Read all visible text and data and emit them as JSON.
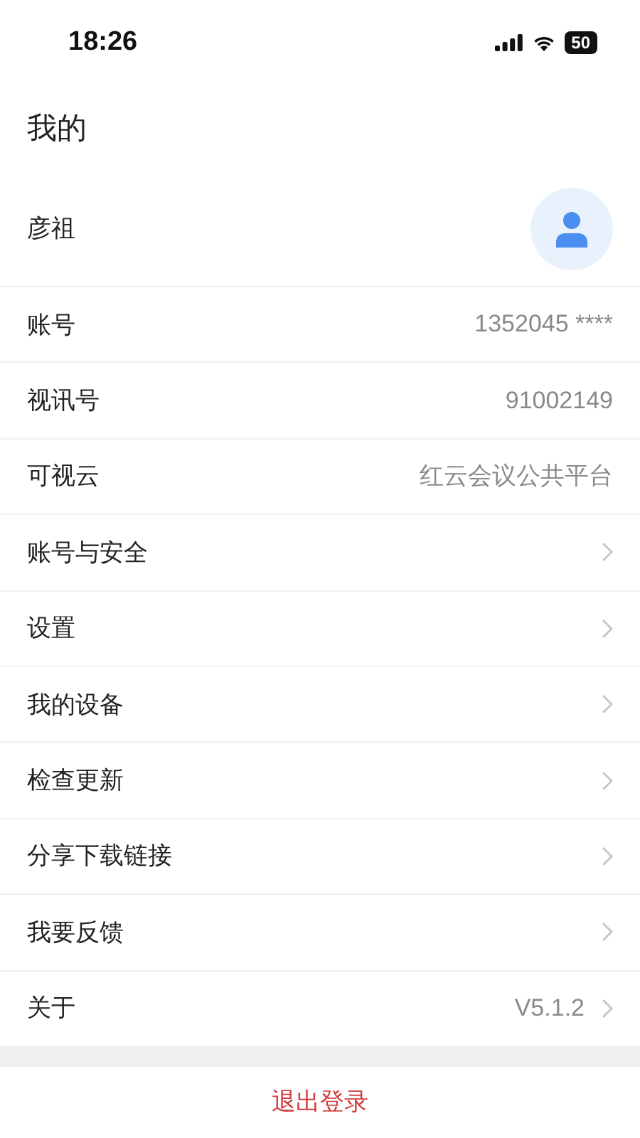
{
  "status_bar": {
    "time": "18:26",
    "battery": "50"
  },
  "title": "我的",
  "profile": {
    "name": "彦祖"
  },
  "rows": [
    {
      "label": "账号",
      "value": "1352045 ****",
      "kind": "info"
    },
    {
      "label": "视讯号",
      "value": "91002149",
      "kind": "info"
    },
    {
      "label": "可视云",
      "value": "红云会议公共平台",
      "kind": "info"
    },
    {
      "label": "账号与安全",
      "kind": "link"
    },
    {
      "label": "设置",
      "kind": "link"
    },
    {
      "label": "我的设备",
      "kind": "link"
    },
    {
      "label": "检查更新",
      "kind": "link"
    },
    {
      "label": "分享下载链接",
      "kind": "link"
    },
    {
      "label": "我要反馈",
      "kind": "link"
    },
    {
      "label": "关于",
      "value": "V5.1.2",
      "kind": "link"
    }
  ],
  "logout": "退出登录"
}
